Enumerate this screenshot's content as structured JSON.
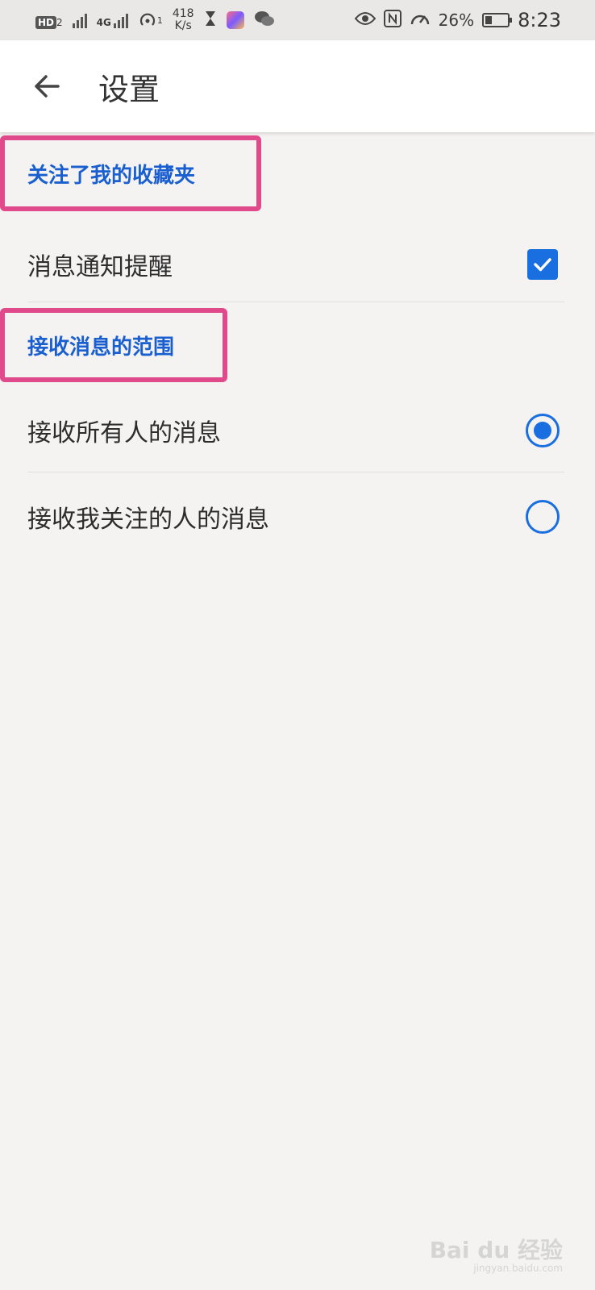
{
  "status_bar": {
    "hd": "HD",
    "hd_sub": "2",
    "network": "4G",
    "wifi_sub": "1",
    "speed_value": "418",
    "speed_unit": "K/s",
    "battery_percent": "26%",
    "time": "8:23"
  },
  "app_bar": {
    "title": "设置"
  },
  "sections": {
    "followed": {
      "header": "关注了我的收藏夹",
      "notification_label": "消息通知提醒",
      "notification_checked": true
    },
    "scope": {
      "header": "接收消息的范围",
      "option_all": "接收所有人的消息",
      "option_followed": "接收我关注的人的消息",
      "selected": "option_all"
    }
  },
  "colors": {
    "accent": "#1a6fe0",
    "header_text": "#1a5fd0",
    "highlight_border": "#e04a8a"
  },
  "watermark": {
    "brand": "Bai du 经验",
    "url": "jingyan.baidu.com"
  }
}
